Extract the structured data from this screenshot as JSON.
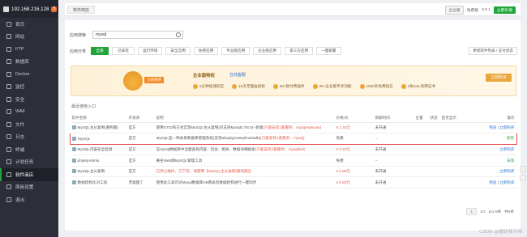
{
  "sidebar": {
    "host": "192.168.216.128",
    "badge": "5",
    "items": [
      {
        "label": "首页",
        "icon": "home-icon"
      },
      {
        "label": "网站",
        "icon": "globe-icon"
      },
      {
        "label": "FTP",
        "icon": "ftp-icon"
      },
      {
        "label": "数据库",
        "icon": "database-icon"
      },
      {
        "label": "Docker",
        "icon": "docker-icon"
      },
      {
        "label": "监控",
        "icon": "monitor-icon"
      },
      {
        "label": "安全",
        "icon": "shield-icon"
      },
      {
        "label": "WAF",
        "icon": "waf-icon"
      },
      {
        "label": "文件",
        "icon": "folder-icon"
      },
      {
        "label": "日志",
        "icon": "log-icon"
      },
      {
        "label": "终端",
        "icon": "terminal-icon"
      },
      {
        "label": "计划任务",
        "icon": "clock-icon"
      },
      {
        "label": "软件商店",
        "icon": "store-icon",
        "active": true
      },
      {
        "label": "面板设置",
        "icon": "gear-icon"
      },
      {
        "label": "退出",
        "icon": "logout-icon"
      }
    ]
  },
  "topbar": {
    "tab": "软件商店",
    "edition": "企业版",
    "free": "免费版",
    "version": "8.0.1",
    "upgrade": "立即升级"
  },
  "search": {
    "label": "应用搜索",
    "value": "mysql"
  },
  "categories": {
    "label": "应用分类",
    "items": [
      "全部",
      "已安装",
      "运行环境",
      "安全应用",
      "免费应用",
      "专业版应用",
      "企业版应用",
      "第三方应用",
      "一键部署"
    ],
    "refresh": "更新软件列表 / 支付状态"
  },
  "banner": {
    "tag": "立即购买",
    "title": "企业版特权",
    "consult": "在线客服",
    "features": [
      "5分钟极速响应",
      "15天无理由退款",
      "30+款付费插件",
      "20+企业版专享功能",
      "1000条免费短信",
      "2张SSL商用证书"
    ],
    "buy": "立即购买"
  },
  "recent_label": "最近使用入口",
  "table": {
    "headers": [
      "软件名称",
      "开发商",
      "说明",
      "价格/天",
      "到期时间",
      "位置",
      "状态",
      "首页显示",
      "操作"
    ],
    "rows": [
      {
        "name": "MySQL主从复制(重构版)",
        "dev": "官方",
        "desc": "使用GTID的方式实现MySQL主从复制(仅支持Mysql5.7/8.0)--新版",
        "desc_note": "(只能安装1套服务：mysqlreplicate)",
        "price": "¥ 1.33元",
        "expire": "未开通",
        "op1": "预览",
        "op2": "立即购买"
      },
      {
        "name": "MySQL",
        "dev": "官方",
        "desc": "MySQL是一种关系数据库管理系统(支持alisql/greatsql/mariadb)",
        "desc_note": "(只能安装1套服务：mysql)",
        "price": "免费",
        "expire": "--",
        "op1": "",
        "op2": "安装"
      },
      {
        "name": "MySQL内容安全检测",
        "dev": "官方",
        "desc": "在mysql数据库中全面查找内容：包含、相关、数据详细搜索",
        "desc_note": "(只能安装1套服务：mysqlfind)",
        "price": "¥ 0.33元",
        "expire": "未开通",
        "op1": "",
        "op2": "立即购买"
      },
      {
        "name": "phpMyAdmin",
        "dev": "官方",
        "desc": "著名Web端MySQL管理工具",
        "desc_note": "",
        "price": "免费",
        "expire": "--",
        "op1": "",
        "op2": "安装"
      },
      {
        "name": "MySQL主从复制",
        "dev": "官方",
        "desc": "已停止维护，已下架，请使用【MySQL主从复制(重构版)】",
        "desc_note": "",
        "price": "¥ 0.99元",
        "expire": "未开通",
        "op1": "",
        "op2": "立即购买"
      },
      {
        "name": "数据结构比对工具",
        "dev": "老狐狸了",
        "desc": "使用此工具可对Mysql数据库AB两表的数据结构进行一键同步",
        "desc_note": "",
        "price": "¥ 0.50元",
        "expire": "未开通",
        "op1": "预览",
        "op2": "立即购买"
      }
    ]
  },
  "pager": {
    "current": "1",
    "total": "1/1",
    "range": "从1-6条",
    "count": "共6条"
  },
  "watermark": "CSDN @傲娇我不帅",
  "colors": {
    "accent": "#20a53a",
    "sidebar": "#2c2f3a",
    "warning": "#e25a4a",
    "highlight_border": "#e54b4b"
  }
}
